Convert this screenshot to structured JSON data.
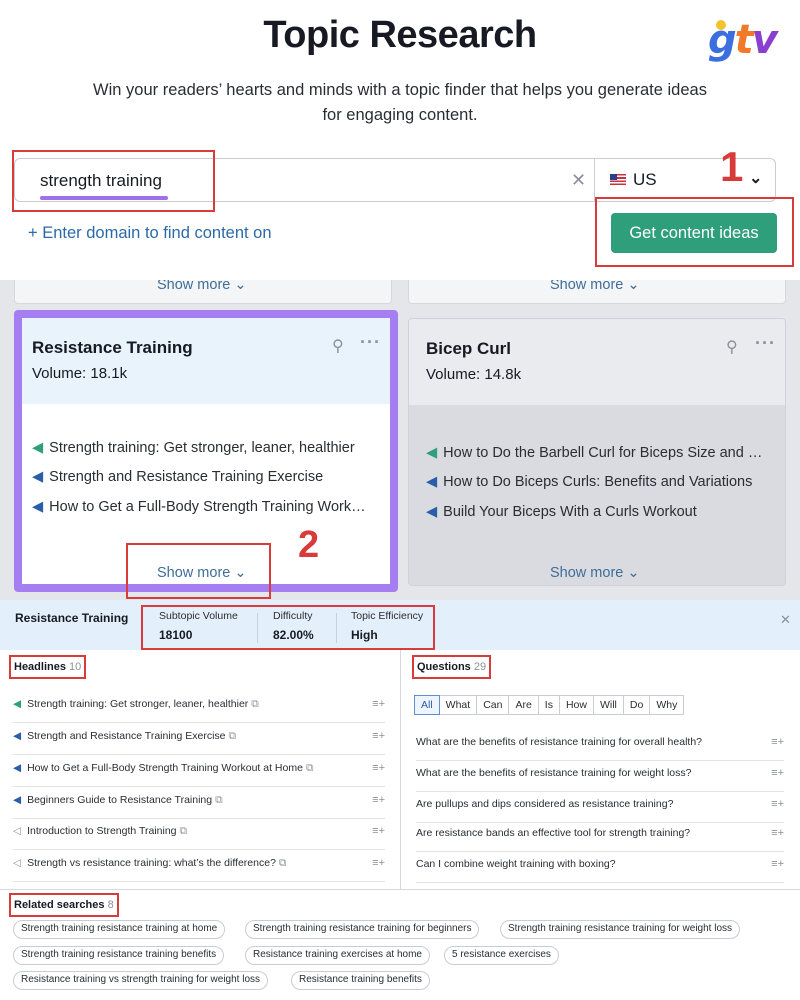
{
  "hero": {
    "title": "Topic Research",
    "subtitle_line1": "Win your readers’ hearts and minds with a topic finder that helps you generate ideas",
    "subtitle_line2": "for engaging content.",
    "logo": "gtv",
    "keyword_value": "strength training",
    "database_value": "US",
    "domain_link": "+ Enter domain to find content on",
    "cta_label": "Get content ideas",
    "annotation_1": "1",
    "annotation_2": "2"
  },
  "cards": {
    "show_more_label": "Show more",
    "items": [
      {
        "title": "Resistance Training",
        "volume_label": "Volume:",
        "volume_value": "18.1k",
        "lines": [
          "Strength training: Get stronger, leaner, healthier",
          "Strength and Resistance Training Exercise",
          "How to Get a Full-Body Strength Training Workout at Home"
        ]
      },
      {
        "title": "Bicep Curl",
        "volume_label": "Volume:",
        "volume_value": "14.8k",
        "lines": [
          "How to Do the Barbell Curl for Biceps Size and Strength",
          "How to Do Biceps Curls: Benefits and Variations",
          "Build Your Biceps With a Curls Workout"
        ]
      }
    ]
  },
  "panel": {
    "title": "Resistance Training",
    "metrics": [
      {
        "label": "Subtopic Volume",
        "value": "18100"
      },
      {
        "label": "Difficulty",
        "value": "82.00%"
      },
      {
        "label": "Topic Efficiency",
        "value": "High"
      }
    ],
    "headlines_label": "Headlines",
    "headlines_count": "10",
    "headlines": [
      "Strength training: Get stronger, leaner, healthier",
      "Strength and Resistance Training Exercise",
      "How to Get a Full-Body Strength Training Workout at Home",
      "Beginners Guide to Resistance Training",
      "Introduction to Strength Training",
      "Strength vs resistance training: what’s the difference?"
    ],
    "questions_label": "Questions",
    "questions_count": "29",
    "question_tabs": [
      "All",
      "What",
      "Can",
      "Are",
      "Is",
      "How",
      "Will",
      "Do",
      "Why"
    ],
    "active_tab": "All",
    "questions": [
      "What are the benefits of resistance training for overall health?",
      "What are the benefits of resistance training for weight loss?",
      "Are pullups and dips considered as resistance training?",
      "Are resistance bands an effective tool for strength training?",
      "Can I combine weight training with boxing?"
    ],
    "related_label": "Related searches",
    "related_count": "8",
    "related": [
      "Strength training resistance training at home",
      "Strength training resistance training for beginners",
      "Strength training resistance training for weight loss",
      "Strength training resistance training benefits",
      "Resistance training exercises at home",
      "5 resistance exercises",
      "Resistance training vs strength training for weight loss",
      "Resistance training benefits"
    ]
  },
  "colors": {
    "accent_green": "#2f9e7b",
    "highlight_purple": "#a57ef2",
    "annotation_red": "#d93b3b",
    "link_blue": "#2b6aa8"
  }
}
